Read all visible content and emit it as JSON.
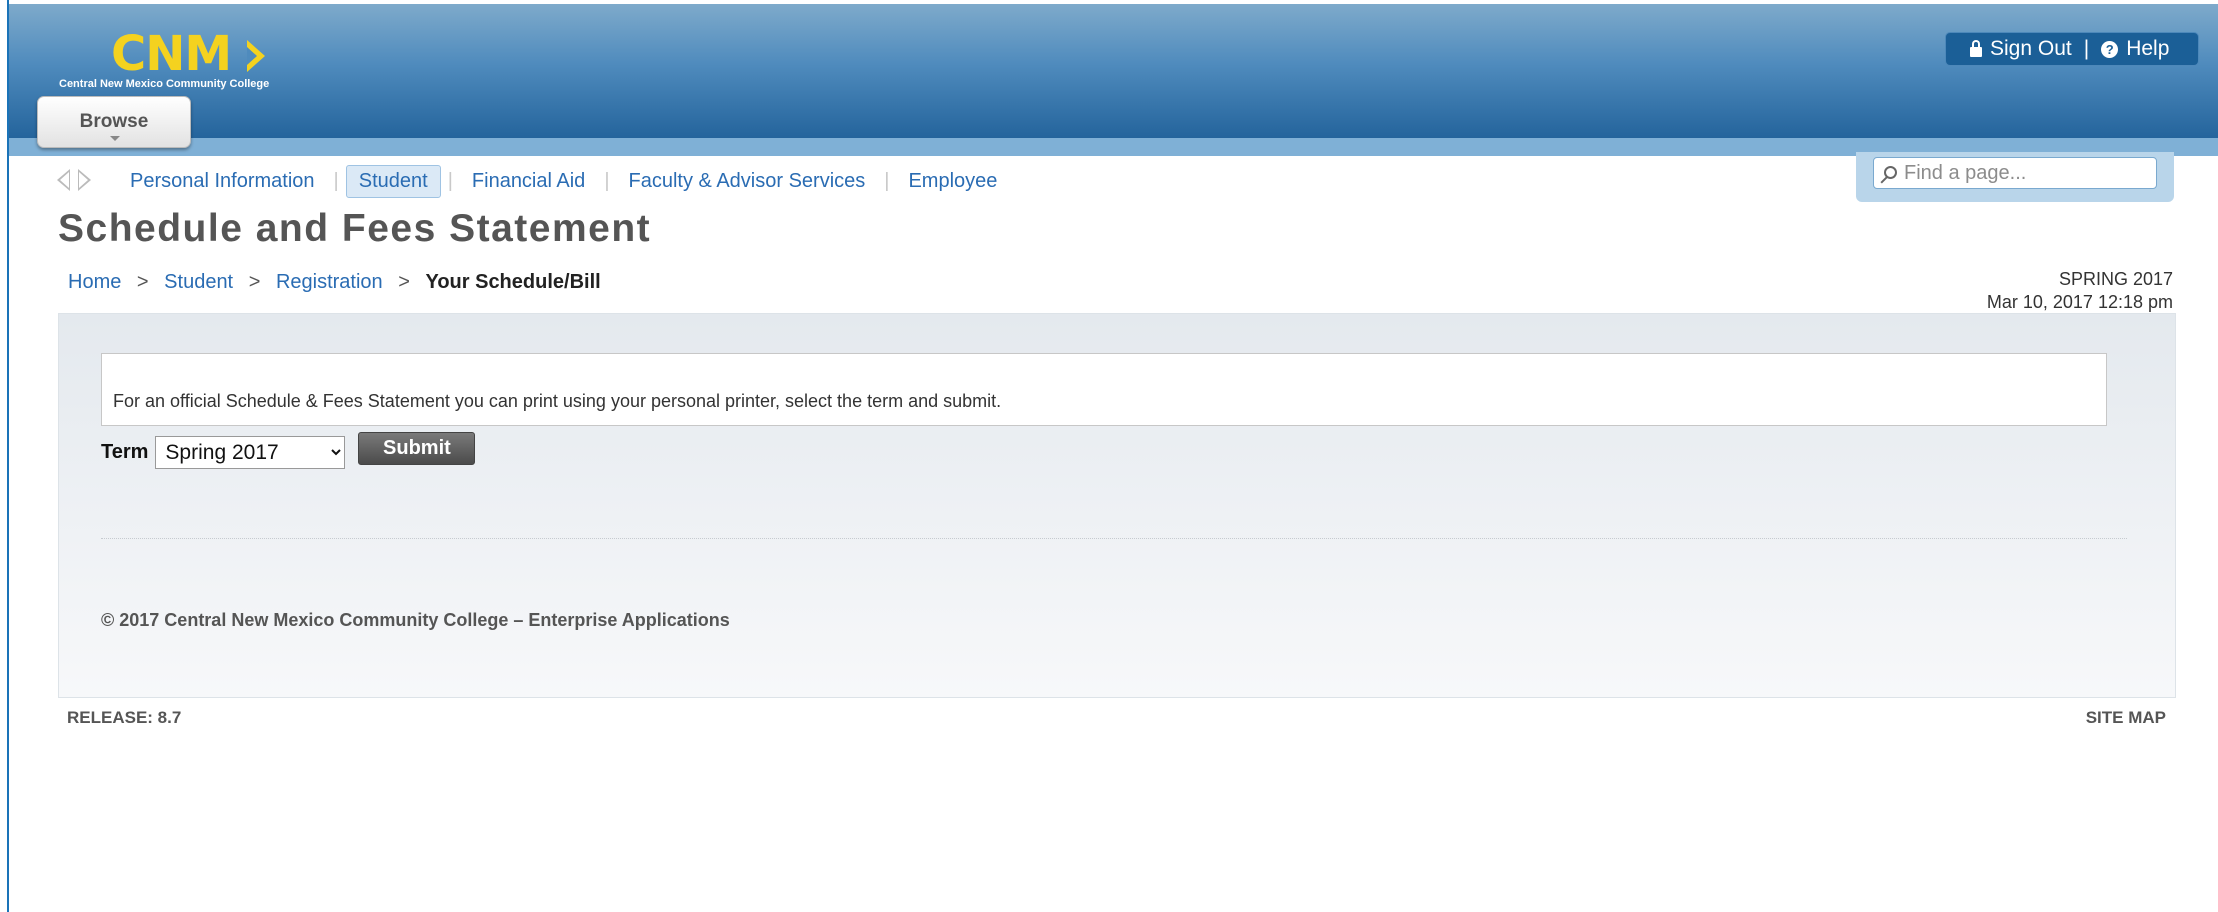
{
  "header": {
    "logo_text": "CNM",
    "logo_subtitle": "Central New Mexico Community College",
    "browse_label": "Browse",
    "sign_out_label": "Sign Out",
    "help_label": "Help",
    "separator": "|"
  },
  "search": {
    "placeholder": "Find a page..."
  },
  "nav": {
    "items": [
      {
        "label": "Personal Information",
        "active": false
      },
      {
        "label": "Student",
        "active": true
      },
      {
        "label": "Financial Aid",
        "active": false
      },
      {
        "label": "Faculty & Advisor Services",
        "active": false
      },
      {
        "label": "Employee",
        "active": false
      }
    ]
  },
  "page": {
    "title": "Schedule and Fees Statement"
  },
  "breadcrumb": {
    "items": [
      "Home",
      "Student",
      "Registration"
    ],
    "current": "Your Schedule/Bill",
    "separator": ">"
  },
  "term_info": {
    "term": "SPRING 2017",
    "datetime": "Mar 10, 2017 12:18 pm"
  },
  "content": {
    "instruction": "For an official Schedule & Fees Statement you can print using your personal printer, select the term and submit.",
    "term_label": "Term",
    "term_selected": "Spring 2017",
    "submit_label": "Submit",
    "copyright": "© 2017 Central New Mexico Community College – Enterprise Applications"
  },
  "footer": {
    "release": "RELEASE: 8.7",
    "site_map": "SITE MAP"
  },
  "colors": {
    "header_blue": "#24649c",
    "logo_yellow": "#f4d21f",
    "link_blue": "#2a6cb3"
  }
}
